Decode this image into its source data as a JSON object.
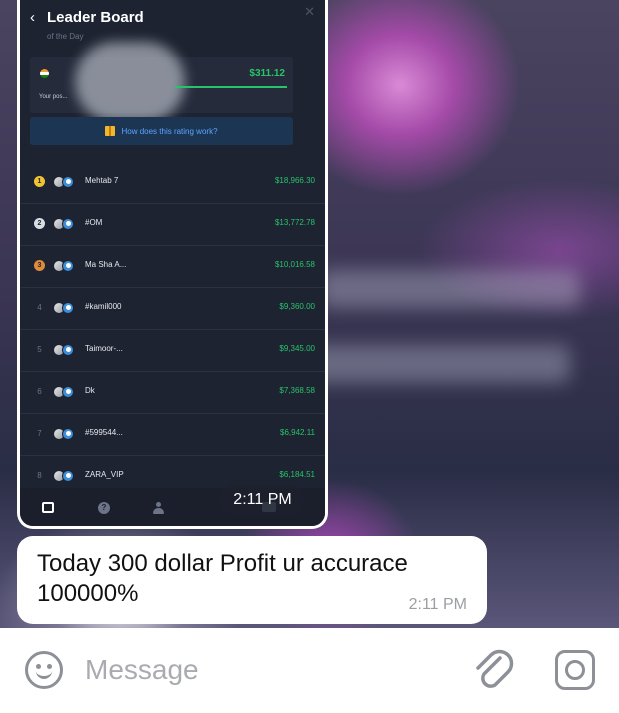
{
  "leaderboard": {
    "title": "Leader Board",
    "subtitle": "of the Day",
    "back_icon": "chevron-left",
    "close_icon": "close",
    "your_position": {
      "amount": "$311.12",
      "label": "Your pos..."
    },
    "rating_link": "How does this rating work?",
    "rows": [
      {
        "rank": "1",
        "name": "Mehtab 7",
        "amount": "$18,966.30"
      },
      {
        "rank": "2",
        "name": "#OM",
        "amount": "$13,772.78"
      },
      {
        "rank": "3",
        "name": "Ma Sha A...",
        "amount": "$10,016.58"
      },
      {
        "rank": "4",
        "name": "#kamil000",
        "amount": "$9,360.00"
      },
      {
        "rank": "5",
        "name": "Taimoor-...",
        "amount": "$9,345.00"
      },
      {
        "rank": "6",
        "name": "Dk",
        "amount": "$7,368.58"
      },
      {
        "rank": "7",
        "name": "#599544...",
        "amount": "$6,942.11"
      },
      {
        "rank": "8",
        "name": "ZARA_VIP",
        "amount": "$6,184.51"
      }
    ],
    "colors": {
      "profit": "#27c46a",
      "background": "#1e2331",
      "link": "#5fa4ff"
    }
  },
  "image_message": {
    "time": "2:11 PM"
  },
  "text_message": {
    "text": "Today 300 dollar Profit ur accurace 100000%",
    "time": "2:11 PM"
  },
  "composer": {
    "placeholder": "Message",
    "icons": [
      "emoji-icon",
      "attach-icon",
      "camera-icon"
    ]
  }
}
